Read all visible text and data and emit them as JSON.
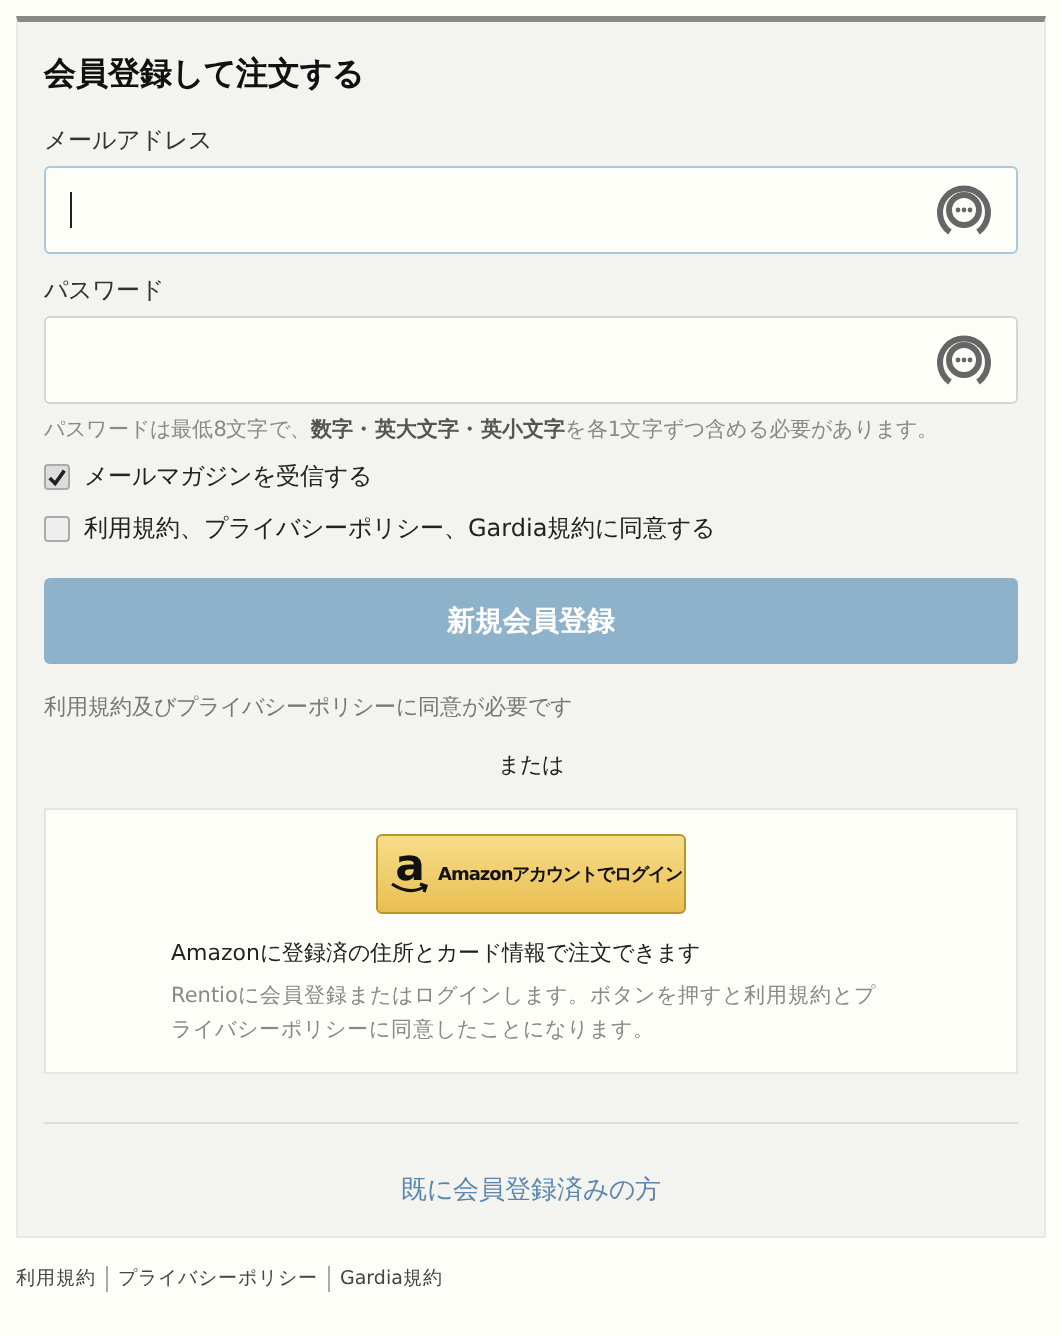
{
  "title": "会員登録して注文する",
  "fields": [
    {
      "label": "メールアドレス",
      "focused": true
    },
    {
      "label": "パスワード",
      "focused": false
    }
  ],
  "password_hint": "パスワードは最低8文字で、**数字・英大文字・英小文字**を各1文字ずつ含める必要があります。",
  "checkboxes": [
    {
      "label": "メールマガジンを受信する",
      "checked": true
    },
    {
      "label": "利用規約、プライバシーポリシー、Gardia規約に同意する",
      "checked": false
    }
  ],
  "register_button": {
    "label": "新規会員登録",
    "disabled": true
  },
  "consent_note": "利用規約及びプライバシーポリシーに同意が必要です",
  "or_text": "または",
  "amazon": {
    "logo_letter": "a",
    "button_label": "Amazonアカウントでログイン",
    "description": "Amazonに登録済の住所とカード情報で注文できます",
    "note": "Rentioに会員登録またはログインします。ボタンを押すと利用規約とプライバシーポリシーに同意したことになります。"
  },
  "login_link": "既に会員登録済みの方",
  "footer_links": [
    "利用規約",
    "プライバシーポリシー",
    "Gardia規約"
  ]
}
